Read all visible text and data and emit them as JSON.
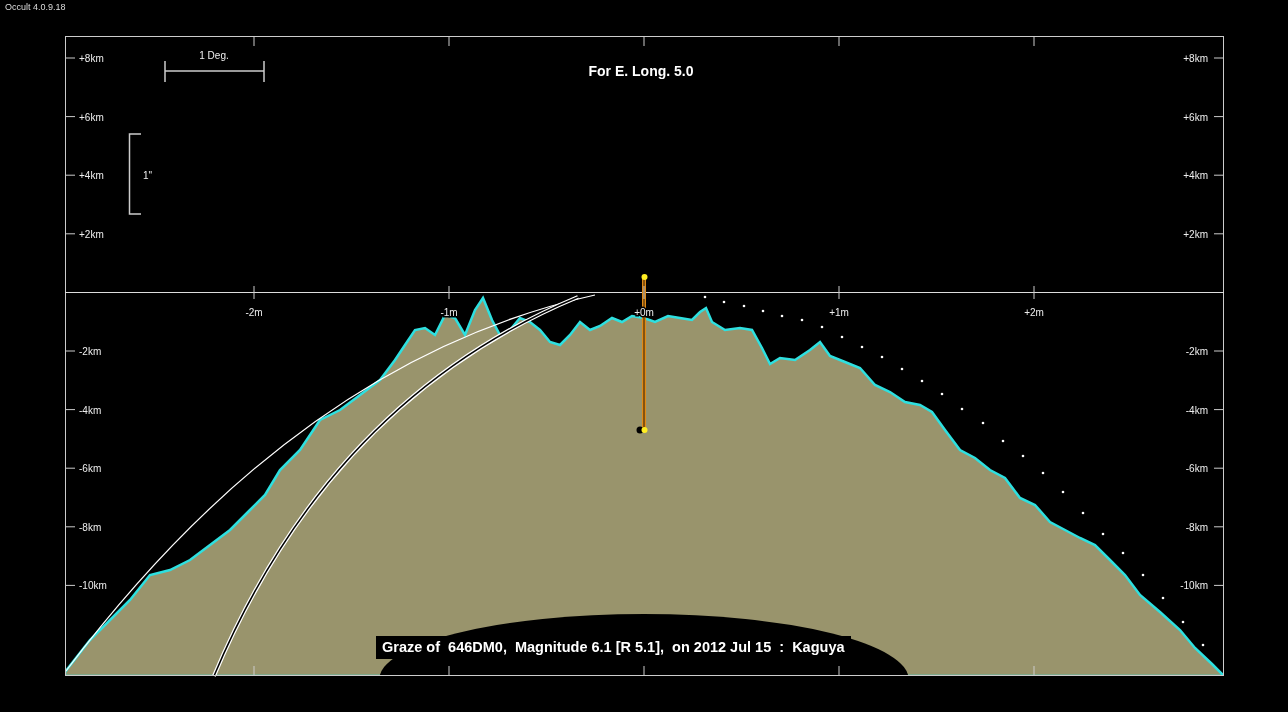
{
  "window": {
    "title": "Occult 4.0.9.18"
  },
  "plot": {
    "title": "For E. Long. 5.0",
    "scale_bar_label": "1 Deg.",
    "scale_bracket_label": "1\"",
    "y_ticks_upper_left": [
      "+8km",
      "+6km",
      "+4km",
      "+2km"
    ],
    "y_ticks_lower_left": [
      "-2km",
      "-4km",
      "-6km",
      "-8km",
      "-10km"
    ],
    "y_ticks_upper_right": [
      "+8km",
      "+6km",
      "+4km",
      "+2km"
    ],
    "y_ticks_lower_right": [
      "-2km",
      "-4km",
      "-6km",
      "-8km",
      "-10km"
    ],
    "x_ticks": [
      "-2m",
      "-1m",
      "+0m",
      "+1m",
      "+2m"
    ],
    "caption": "Graze of  646DM0,  Magnitude 6.1 [R 5.1],  on 2012 Jul 15  :  Kaguya"
  }
}
